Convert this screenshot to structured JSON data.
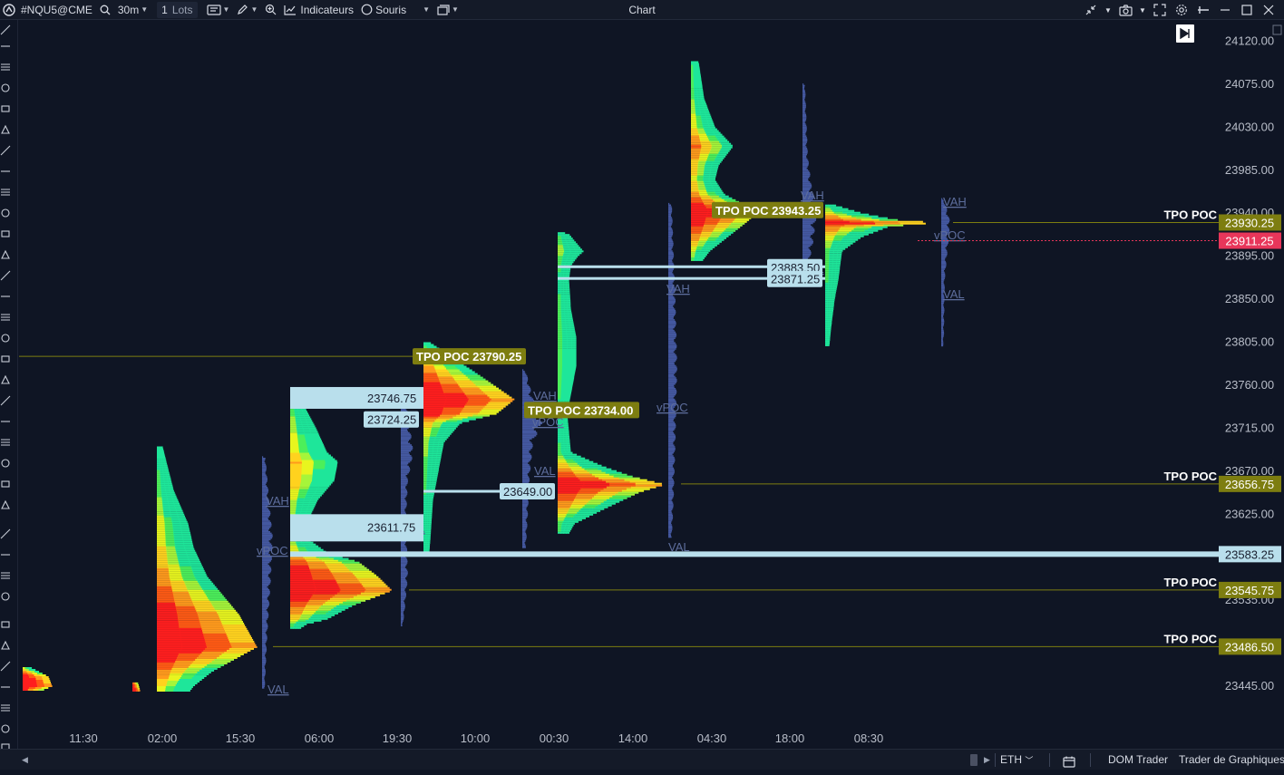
{
  "toolbar": {
    "symbol": "#NQU5@CME",
    "timeframe": "30m",
    "lots_value": "1",
    "lots_label": "Lots",
    "indicators_label": "Indicateurs",
    "mouse_label": "Souris"
  },
  "window": {
    "title": "Chart"
  },
  "chart_data": {
    "type": "market-profile",
    "price_axis_ticks": [
      "24120.00",
      "24075.00",
      "24030.00",
      "23985.00",
      "23940.00",
      "23895.00",
      "23850.00",
      "23805.00",
      "23760.00",
      "23715.00",
      "23670.00",
      "23625.00",
      "23535.00",
      "23445.00"
    ],
    "time_axis_ticks": [
      "11:30",
      "02:00",
      "15:30",
      "06:00",
      "19:30",
      "10:00",
      "00:30",
      "14:00",
      "04:30",
      "18:00",
      "08:30"
    ],
    "right_poc_labels": [
      {
        "text": "TPO POC",
        "price": "23930.25"
      },
      {
        "text": "TPO POC",
        "price": "23656.75"
      },
      {
        "text": "TPO POC",
        "price": "23545.75"
      },
      {
        "text": "TPO POC",
        "price": "23486.50"
      }
    ],
    "current_price": "23911.25",
    "hline_price": "23583.25",
    "inline_poc_labels": [
      "TPO POC 23943.25",
      "TPO POC 23790.25",
      "TPO POC 23734.00"
    ],
    "naked_level_labels": [
      "23883.50",
      "23871.25",
      "23746.75",
      "23724.25",
      "23649.00",
      "23611.75"
    ],
    "volume_labels": {
      "vah": "VAH",
      "val": "VAL",
      "vpoc": "vPOC"
    },
    "colors": {
      "poc_tag": "#7d7d10",
      "current_price": "#e8365a",
      "level_box": "#b9dfec",
      "volume_profile": "#4a5fae"
    }
  },
  "bottombar": {
    "session": "ETH",
    "dom_trader": "DOM Trader",
    "chart_trader": "Trader de Graphiques"
  }
}
